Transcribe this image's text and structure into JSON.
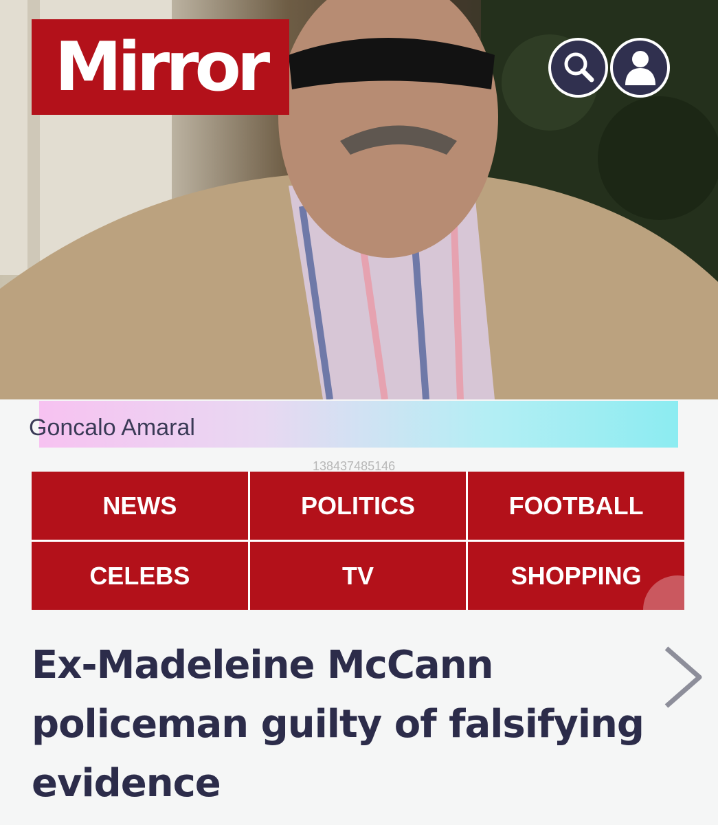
{
  "header": {
    "logo_text": "Mirror",
    "brand_color": "#b3111a",
    "icons": [
      "search-icon",
      "account-icon"
    ]
  },
  "hero": {
    "caption": "Goncalo Amaral",
    "ad_id": "138437485146"
  },
  "nav": {
    "items": [
      "NEWS",
      "POLITICS",
      "FOOTBALL",
      "CELEBS",
      "TV",
      "SHOPPING"
    ]
  },
  "article": {
    "headline": "Ex-Madeleine McCann policeman guilty of falsifying evidence"
  }
}
